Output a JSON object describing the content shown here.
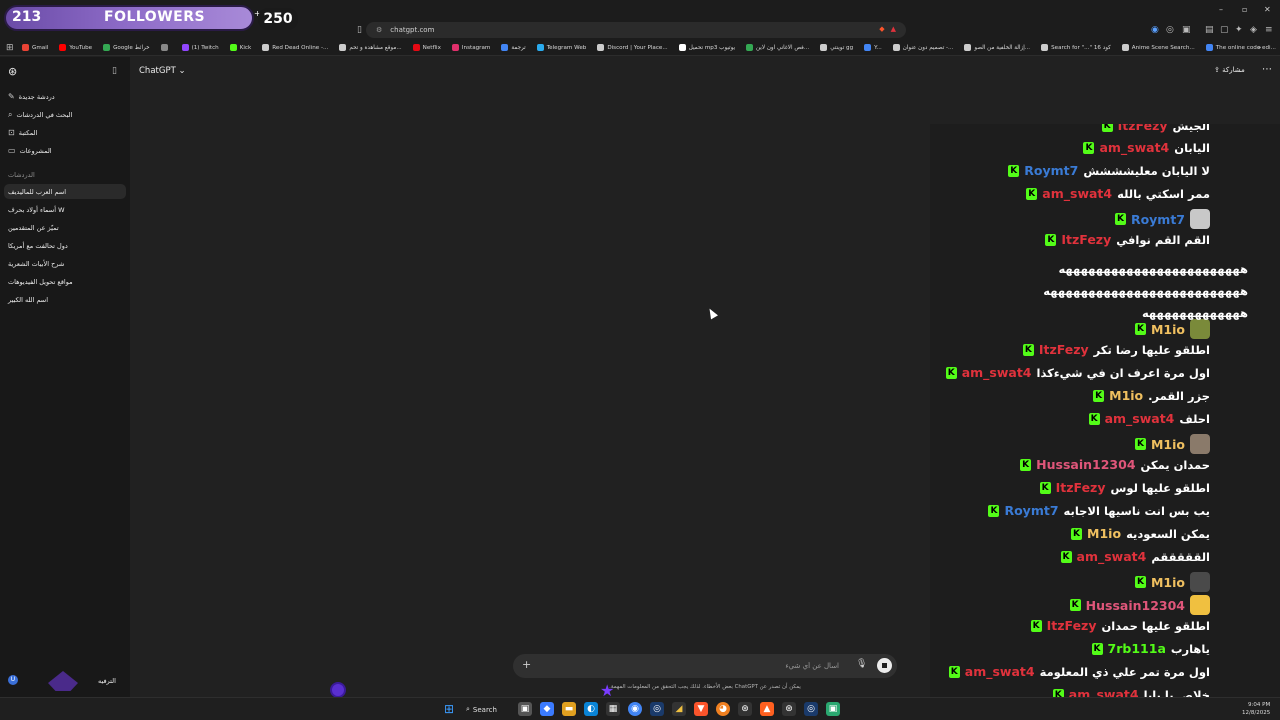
{
  "browser": {
    "url": "chatgpt.com",
    "bookmarks": [
      {
        "label": "Gmail",
        "color": "#ea4335"
      },
      {
        "label": "YouTube",
        "color": "#ff0000"
      },
      {
        "label": "Google خرائط",
        "color": "#34a853"
      },
      {
        "label": "",
        "color": "#888888"
      },
      {
        "label": "(1) Twitch",
        "color": "#9146ff"
      },
      {
        "label": "Kick",
        "color": "#53fc18"
      },
      {
        "label": "Red Dead Online -...",
        "color": "#cccccc"
      },
      {
        "label": "موقع مشاهدة و تحم...",
        "color": "#cccccc"
      },
      {
        "label": "Netflix",
        "color": "#e50914"
      },
      {
        "label": "Instagram",
        "color": "#e1306c"
      },
      {
        "label": "ترجمة",
        "color": "#4285f4"
      },
      {
        "label": "Telegram Web",
        "color": "#2aabee"
      },
      {
        "label": "Discord | Your Place...",
        "color": "#cccccc"
      },
      {
        "label": "تحميل mp3 يوتيوب",
        "color": "#ffffff"
      },
      {
        "label": "فص الاغاني اون لاين...",
        "color": "#34a853"
      },
      {
        "label": "توينتي gg",
        "color": "#cccccc"
      },
      {
        "label": "Y...",
        "color": "#4285f4"
      },
      {
        "label": "تصميم دون عنوان -...",
        "color": "#cccccc"
      },
      {
        "label": "إزالة الخلفية من الصو...",
        "color": "#cccccc"
      },
      {
        "label": "Search for \"...\" 16 كود",
        "color": "#cccccc"
      },
      {
        "label": "Anime Scene Search...",
        "color": "#cccccc"
      },
      {
        "label": "The online code edi...",
        "color": "#4285f4"
      }
    ]
  },
  "followers": {
    "current": "213",
    "label": "FOLLOWERS",
    "goal": "250",
    "progress": 0.852
  },
  "app": {
    "model": "ChatGPT",
    "share": "مشاركة",
    "nav": [
      {
        "label": "دردشة جديدة",
        "icon": "edit-icon"
      },
      {
        "label": "البحث في الدردشات",
        "icon": "search-icon"
      },
      {
        "label": "المكتبة",
        "icon": "library-icon"
      },
      {
        "label": "المشروعات",
        "icon": "folder-icon"
      }
    ],
    "section_label": "الدردشات",
    "chats": [
      "اسم العرب للماليديف",
      "أسماء أولاد بحرف W",
      "تميّز عن المتقدمين",
      "دول تحالفت مع أمريكا",
      "شرح الأبيات الشعرية",
      "مواقع تحويل الفيديوهات",
      "اسم الله الكبير"
    ],
    "composer_placeholder": "اسأل عن أي شيء",
    "disclaimer": "يمكن أن تصدر عن ChatGPT بعض الأخطاء. لذلك يجب التحقق من المعلومات المهمة."
  },
  "chat_overlay": {
    "messages": [
      {
        "user": "ItzFezy",
        "color": "#e0323c",
        "text": "الجيش"
      },
      {
        "user": "am_swat4",
        "color": "#e0323c",
        "text": "اليابان"
      },
      {
        "user": "Roymt7",
        "color": "#3a7bd5",
        "text": "لا اليابان معليشششش"
      },
      {
        "user": "am_swat4",
        "color": "#e0323c",
        "text": "ممر اسكتي بالله"
      },
      {
        "user": "Roymt7",
        "color": "#3a7bd5",
        "text": "",
        "emote": "#c8c8c8"
      },
      {
        "user": "ItzFezy",
        "color": "#e0323c",
        "text": "القم القم نوافي"
      },
      {
        "user": "M1io",
        "color": "#f0c060",
        "text": "",
        "emote": "#7a8a3a"
      },
      {
        "user": "ItzFezy",
        "color": "#e0323c",
        "text": "اطلقو عليها رضا تكر"
      },
      {
        "user": "am_swat4",
        "color": "#e0323c",
        "text": "اول مرة اعرف ان في شيءكذا"
      },
      {
        "user": "M1io",
        "color": "#f0c060",
        "text": "جزر القمر."
      },
      {
        "user": "am_swat4",
        "color": "#e0323c",
        "text": "احلف"
      },
      {
        "user": "M1io",
        "color": "#f0c060",
        "text": "",
        "emote": "#8a7a6a"
      },
      {
        "user": "Hussain12304",
        "color": "#e0567a",
        "text": "حمدان يمكن"
      },
      {
        "user": "ItzFezy",
        "color": "#e0323c",
        "text": "اطلقو عليها لوس"
      },
      {
        "user": "Roymt7",
        "color": "#3a7bd5",
        "text": "يب بس انت ناسيها الاجابه"
      },
      {
        "user": "M1io",
        "color": "#f0c060",
        "text": "يمكن السعوديه"
      },
      {
        "user": "am_swat4",
        "color": "#e0323c",
        "text": "القققققم"
      },
      {
        "user": "M1io",
        "color": "#f0c060",
        "text": "",
        "emote": "#4a4a4a"
      },
      {
        "user": "Hussain12304",
        "color": "#e0567a",
        "text": "",
        "emote": "#f0c040"
      },
      {
        "user": "ItzFezy",
        "color": "#e0323c",
        "text": "اطلقو عليها حمدان"
      },
      {
        "user": "7rb111a",
        "color": "#53fc18",
        "text": "ياهارب"
      },
      {
        "user": "am_swat4",
        "color": "#e0323c",
        "text": "اول مرة تمر علي ذي المعلومة"
      },
      {
        "user": "am_swat4",
        "color": "#e0323c",
        "text": "خلاص يا بابا"
      }
    ],
    "continuation": [
      "ههههههههههههههههههههههههه",
      "ههههههههههههههههههههههههههه",
      "هههههههههههههه"
    ]
  },
  "taskbar": {
    "search": "Search",
    "time": "9:04 PM",
    "date": "12/8/2025"
  },
  "bottom_left": {
    "text": "الترفيه"
  }
}
